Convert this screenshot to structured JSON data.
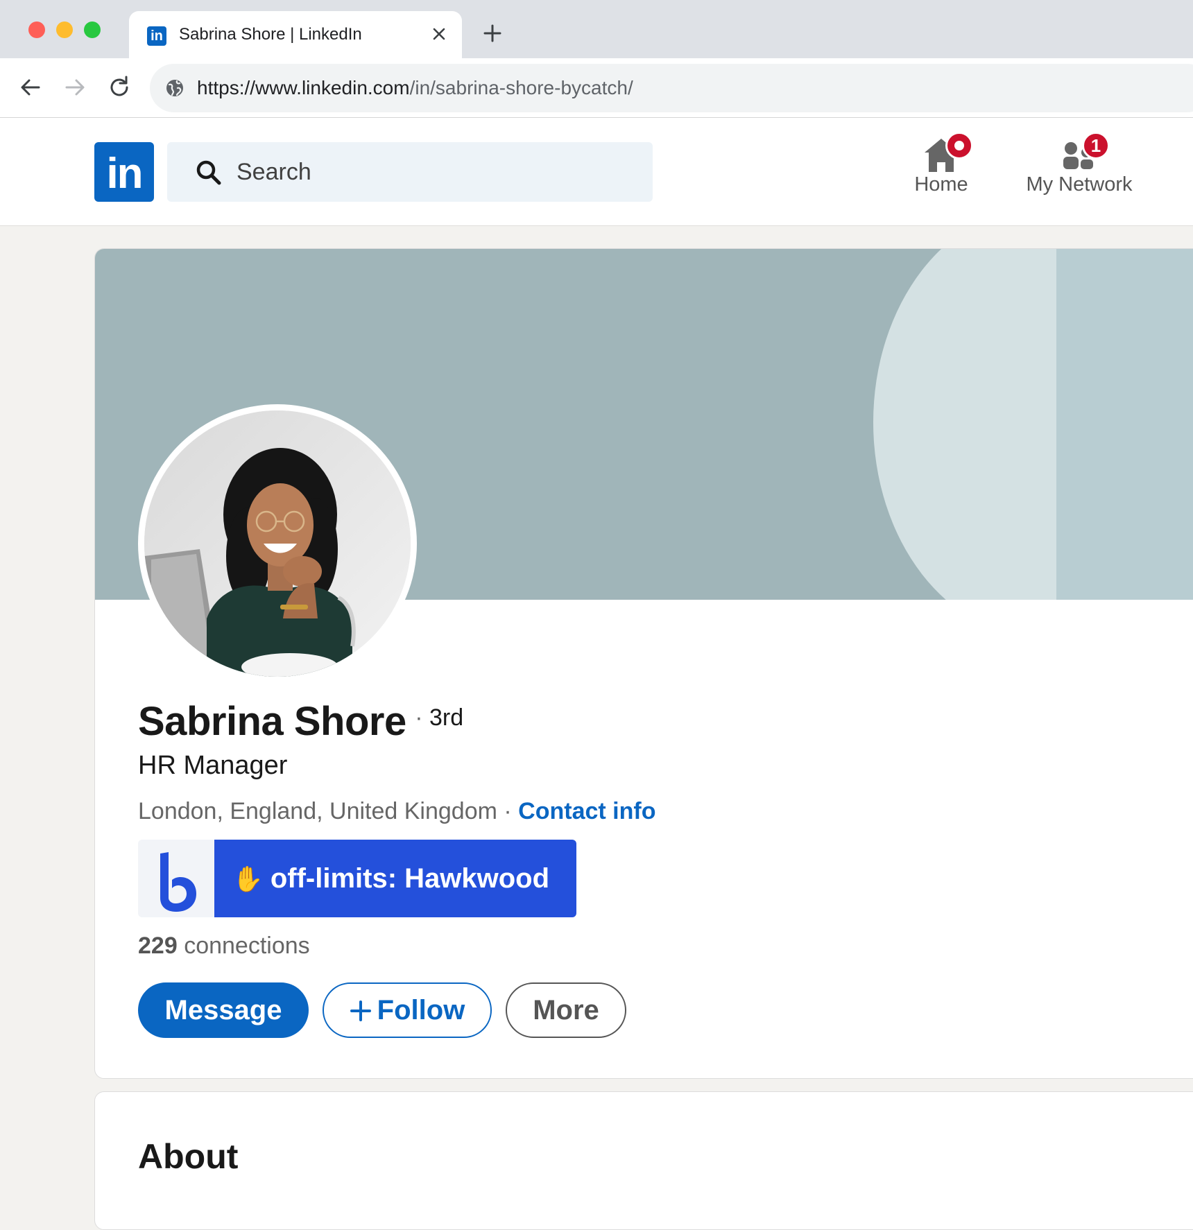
{
  "browser": {
    "tab_title": "Sabrina Shore | LinkedIn",
    "url_host": "https://www.linkedin.com",
    "url_path": "/in/sabrina-shore-bycatch/"
  },
  "nav": {
    "logo_text": "in",
    "search_placeholder": "Search",
    "items": [
      {
        "label": "Home",
        "icon": "home-icon",
        "badge": ""
      },
      {
        "label": "My Network",
        "icon": "network-icon",
        "badge": "1"
      }
    ]
  },
  "profile": {
    "name": "Sabrina Shore",
    "degree": "3rd",
    "headline": "HR Manager",
    "location": "London, England, United Kingdom",
    "contact_label": "Contact info",
    "bycatch_label": "off-limits: Hawkwood",
    "bycatch_emoji": "✋",
    "connections_count": "229",
    "connections_label": "connections",
    "buttons": {
      "message": "Message",
      "follow": "Follow",
      "more": "More"
    }
  },
  "about": {
    "title": "About"
  },
  "colors": {
    "linkedin_blue": "#0a66c2",
    "badge_red": "#cb112d",
    "bycatch_blue": "#2450db",
    "banner": "#a0b5b9"
  }
}
